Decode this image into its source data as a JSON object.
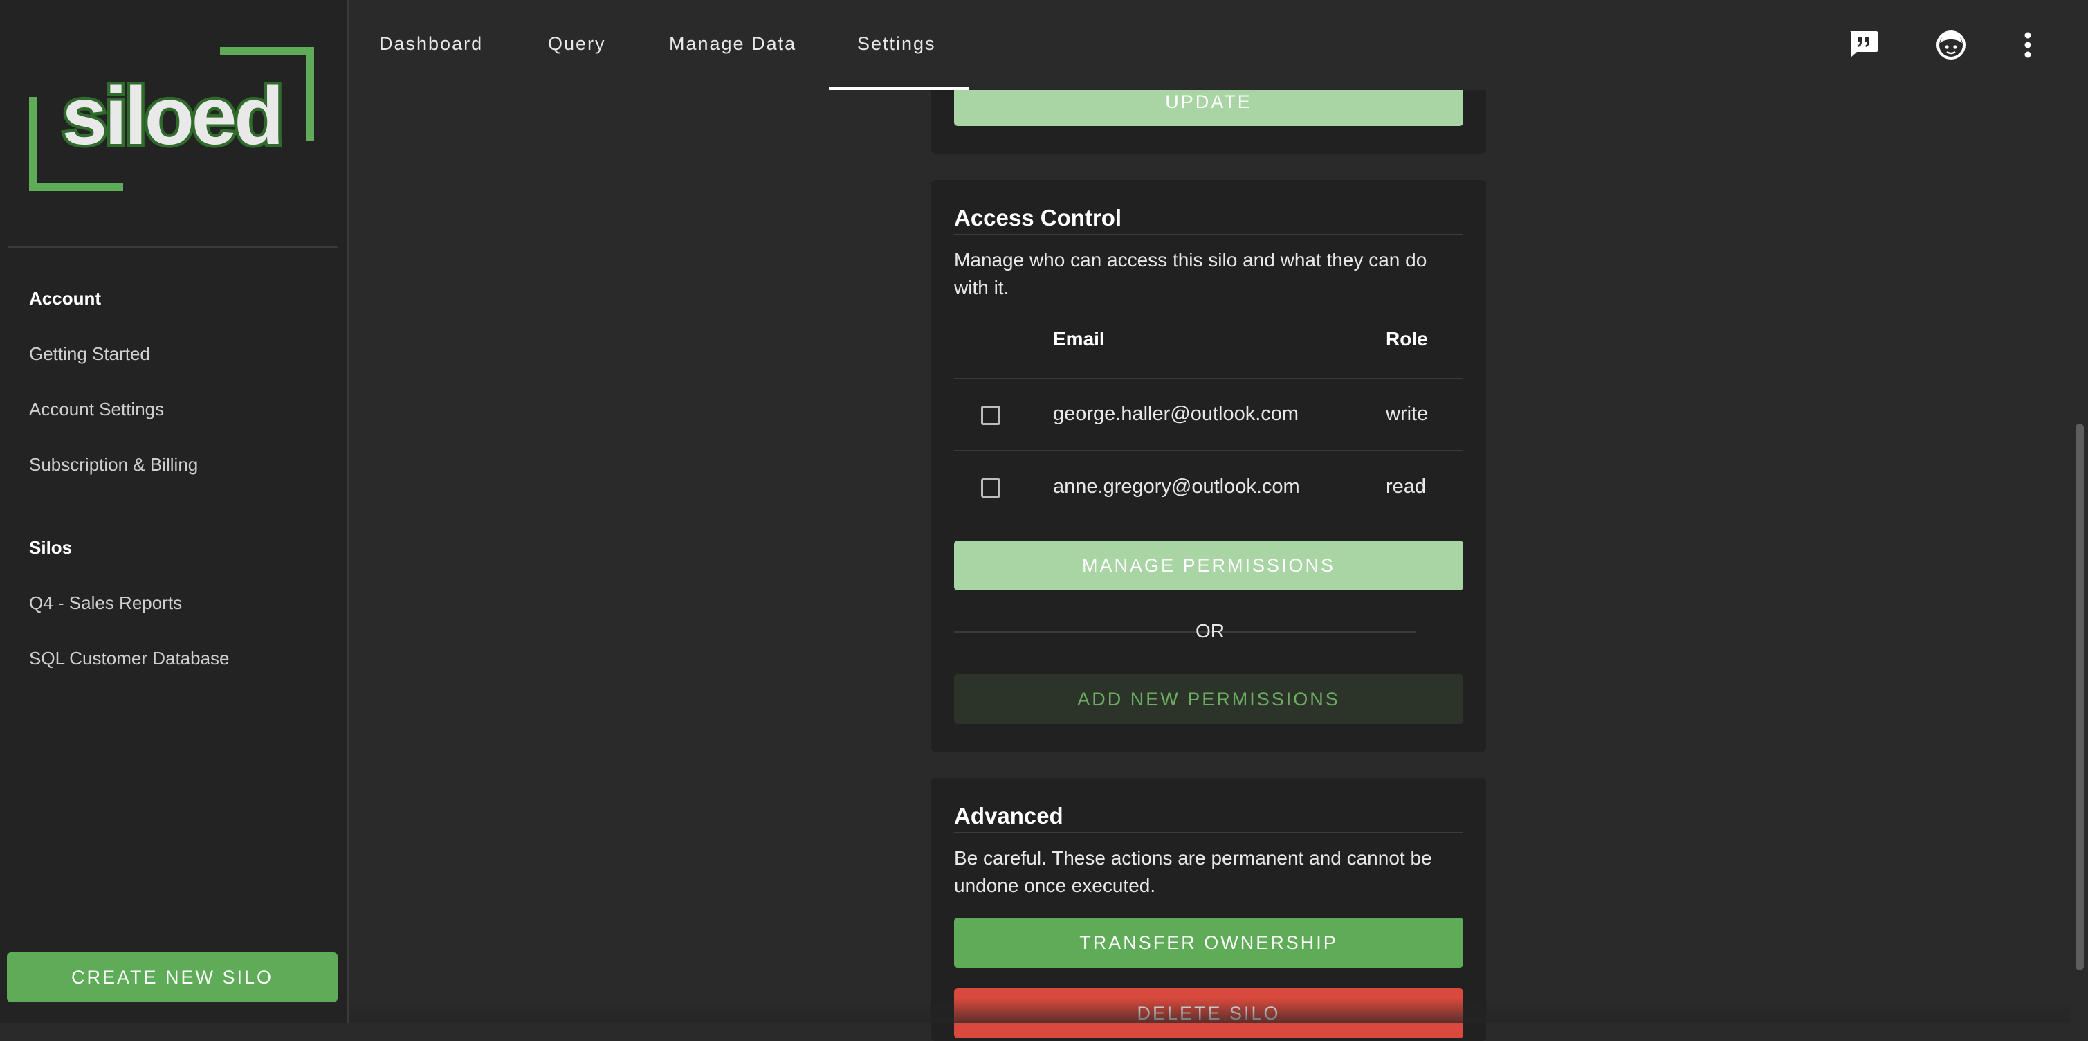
{
  "app": {
    "logo_text": "siloed",
    "brand_color": "#5fac58",
    "accent_light": "#a9d4a4",
    "danger_color": "#d9493d"
  },
  "sidebar": {
    "sections": [
      {
        "heading": "Account",
        "items": [
          {
            "label": "Getting Started"
          },
          {
            "label": "Account Settings"
          },
          {
            "label": "Subscription & Billing"
          }
        ]
      },
      {
        "heading": "Silos",
        "items": [
          {
            "label": "Q4 - Sales Reports"
          },
          {
            "label": "SQL Customer Database"
          }
        ]
      }
    ],
    "create_button": "CREATE NEW SILO"
  },
  "topbar": {
    "tabs": [
      {
        "label": "Dashboard"
      },
      {
        "label": "Query"
      },
      {
        "label": "Manage Data"
      },
      {
        "label": "Settings",
        "active": true
      }
    ],
    "icons": [
      "feedback-icon",
      "account-icon",
      "more-vertical-icon"
    ]
  },
  "update_section": {
    "button": "UPDATE"
  },
  "access_control": {
    "title": "Access Control",
    "description": "Manage who can access this silo and what they can do with it.",
    "columns": {
      "email": "Email",
      "role": "Role"
    },
    "rows": [
      {
        "email": "george.haller@outlook.com",
        "role": "write",
        "checked": false
      },
      {
        "email": "anne.gregory@outlook.com",
        "role": "read",
        "checked": false
      }
    ],
    "manage_button": "MANAGE PERMISSIONS",
    "or_label": "OR",
    "add_button": "ADD NEW PERMISSIONS"
  },
  "advanced": {
    "title": "Advanced",
    "description": "Be careful. These actions are permanent and cannot be undone once executed.",
    "transfer_button": "TRANSFER OWNERSHIP",
    "delete_button": "DELETE SILO"
  }
}
